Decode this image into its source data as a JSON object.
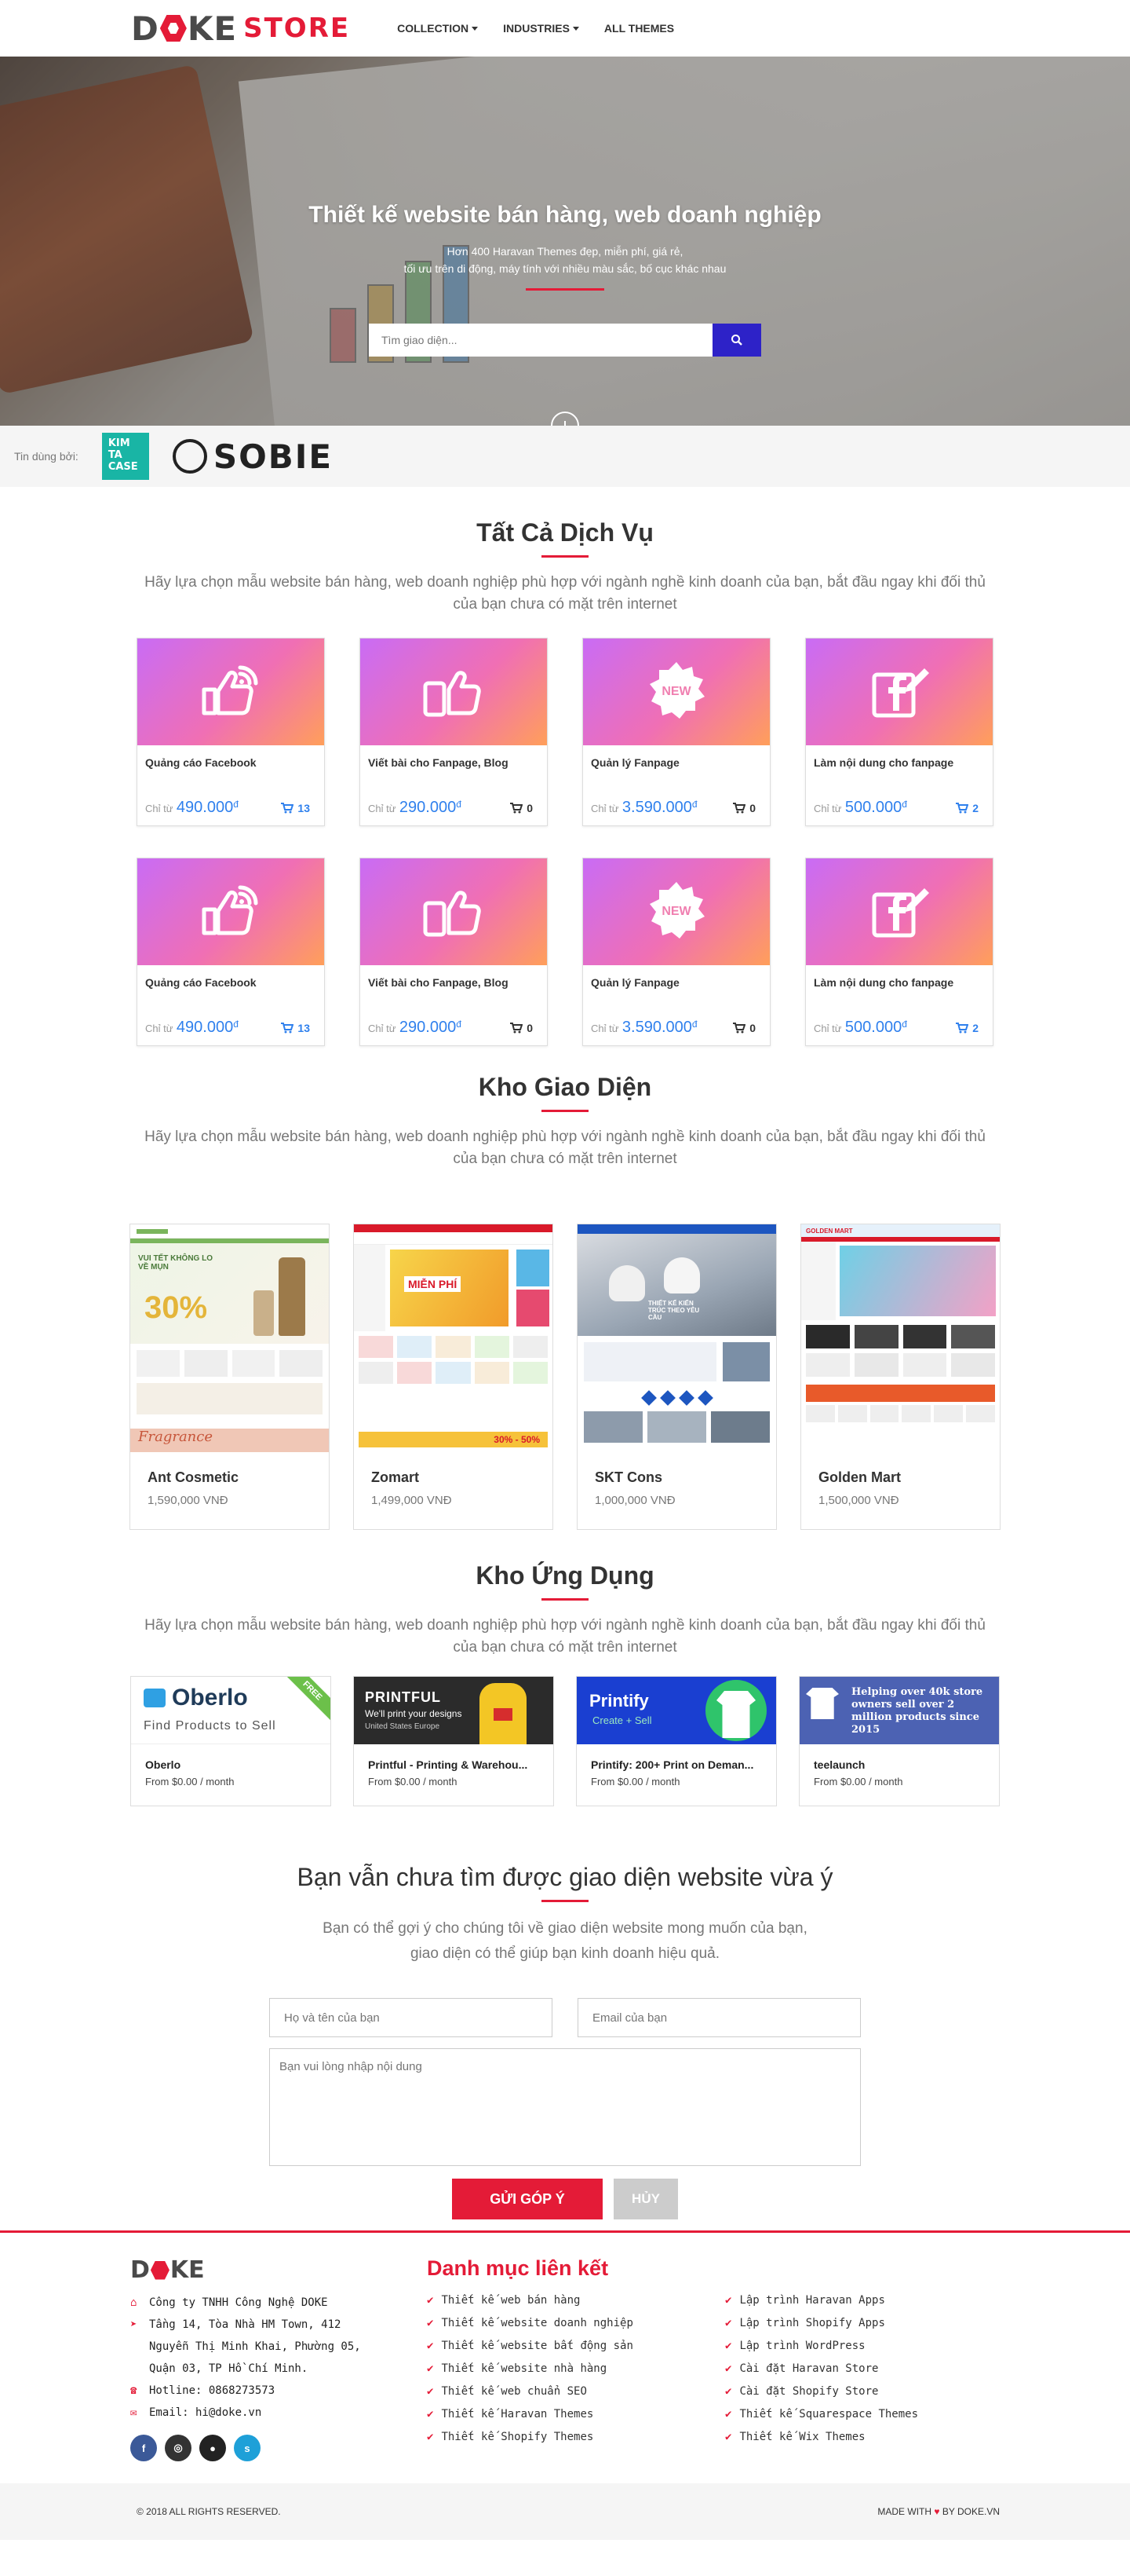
{
  "header": {
    "logo_main": "DOKE",
    "logo_store": "STORE",
    "nav": [
      {
        "label": "COLLECTION",
        "dropdown": true
      },
      {
        "label": "INDUSTRIES",
        "dropdown": true
      },
      {
        "label": "ALL THEMES",
        "dropdown": false
      }
    ]
  },
  "hero": {
    "title": "Thiết kế website bán hàng, web doanh nghiệp",
    "subtitle_1": "Hơn 400 Haravan Themes đẹp, miễn phí, giá rẻ,",
    "subtitle_2": "tối ưu trên di động, máy tính với nhiều màu sắc, bố cục khác nhau",
    "search_placeholder": "Tìm giao diện..."
  },
  "trusted": {
    "label": "Tin dùng bởi:",
    "brands": [
      "KIM TA CASE",
      "SOBIE"
    ]
  },
  "services": {
    "title": "Tất Cả Dịch Vụ",
    "description": "Hãy lựa chọn mẫu website bán hàng, web doanh nghiệp phù hợp với ngành nghề kinh doanh của bạn, bắt đầu ngay khi đối thủ của bạn chưa có mặt trên internet",
    "price_prefix": "Chỉ từ",
    "currency": "đ",
    "items": [
      {
        "name": "Quảng cáo Facebook",
        "price": "490.000",
        "count": "13",
        "icon": "like-wifi-icon",
        "highlight": true
      },
      {
        "name": "Viết bài cho Fanpage, Blog",
        "price": "290.000",
        "count": "0",
        "icon": "phone-thumbs-up-icon",
        "highlight": false
      },
      {
        "name": "Quản lý Fanpage",
        "price": "3.590.000",
        "count": "0",
        "icon": "new-badge-icon",
        "highlight": false
      },
      {
        "name": "Làm nội dung cho fanpage",
        "price": "500.000",
        "count": "2",
        "icon": "facebook-edit-icon",
        "highlight": true
      },
      {
        "name": "Quảng cáo Facebook",
        "price": "490.000",
        "count": "13",
        "icon": "like-wifi-icon",
        "highlight": true
      },
      {
        "name": "Viết bài cho Fanpage, Blog",
        "price": "290.000",
        "count": "0",
        "icon": "phone-thumbs-up-icon",
        "highlight": false
      },
      {
        "name": "Quản lý Fanpage",
        "price": "3.590.000",
        "count": "0",
        "icon": "new-badge-icon",
        "highlight": false
      },
      {
        "name": "Làm nội dung cho fanpage",
        "price": "500.000",
        "count": "2",
        "icon": "facebook-edit-icon",
        "highlight": true
      }
    ]
  },
  "themes": {
    "title": "Kho Giao Diện",
    "description": "Hãy lựa chọn mẫu website bán hàng, web doanh nghiệp phù hợp với ngành nghề kinh doanh của bạn, bắt đầu ngay khi đối thủ của bạn chưa có mặt trên internet",
    "items": [
      {
        "name": "Ant Cosmetic",
        "price": "1,590,000 VNĐ",
        "banner_1": "VUI TẾT KHÔNG LO VỀ MỤN",
        "banner_2": "30%",
        "banner_3": "Fragrance"
      },
      {
        "name": "Zomart",
        "price": "1,499,000 VNĐ",
        "banner_1": "MIỄN PHÍ",
        "banner_2": "30% - 50%"
      },
      {
        "name": "SKT Cons",
        "price": "1,000,000 VNĐ",
        "banner_1": "THIẾT KẾ KIẾN TRÚC THEO YÊU CẦU"
      },
      {
        "name": "Golden Mart",
        "price": "1,500,000 VNĐ",
        "banner_1": "GOLDEN MART"
      }
    ]
  },
  "apps": {
    "title": "Kho Ứng Dụng",
    "description": "Hãy lựa chọn mẫu website bán hàng, web doanh nghiệp phù hợp với ngành nghề kinh doanh của bạn, bắt đầu ngay khi đối thủ của bạn chưa có mặt trên internet",
    "items": [
      {
        "name": "Oberlo",
        "price": "From $0.00 / month",
        "banner_title": "Oberlo",
        "banner_sub": "Find Products to Sell",
        "ribbon": "FREE"
      },
      {
        "name": "Printful - Printing & Warehou...",
        "price": "From $0.00 / month",
        "banner_title": "PRINTFUL",
        "banner_sub": "We'll print your designs",
        "banner_sub2": "United States   Europe"
      },
      {
        "name": "Printify: 200+ Print on Deman...",
        "price": "From $0.00 / month",
        "banner_title": "Printify",
        "banner_sub": "Create + Sell"
      },
      {
        "name": "teelaunch",
        "price": "From $0.00 / month",
        "banner_title": "Helping over 40k store owners sell over 2 million products since 2015"
      }
    ]
  },
  "contact": {
    "title": "Bạn vẫn chưa tìm được giao diện website vừa ý",
    "description_1": "Bạn có thể gợi ý cho chúng tôi về giao diện website mong muốn của bạn,",
    "description_2": "giao diện có thể giúp bạn kinh doanh hiệu quả.",
    "name_placeholder": "Họ và tên của bạn",
    "email_placeholder": "Email của bạn",
    "message_placeholder": "Bạn vui lòng nhập nội dung",
    "submit_label": "GỬI GÓP Ý",
    "cancel_label": "HỦY"
  },
  "footer": {
    "logo": "DOKE",
    "company": "Công ty TNHH Công Nghệ DOKE",
    "address_1": "Tầng 14, Tòa Nhà HM Town, 412",
    "address_2": "Nguyễn Thị Minh Khai, Phường 05,",
    "address_3": "Quận 03, TP Hồ Chí Minh.",
    "hotline": "Hotline: 0868273573",
    "email": "Email: hi@doke.vn",
    "links_title": "Danh mục liên kết",
    "links": [
      "Thiết kế web bán hàng",
      "Lập trình Haravan Apps",
      "Thiết kế website doanh nghiệp",
      "Lập trình Shopify Apps",
      "Thiết kế website bất động sản",
      "Lập trình WordPress",
      "Thiết kế website nhà hàng",
      "Cài đặt Haravan Store",
      "Thiết kế web chuẩn SEO",
      "Cài đặt Shopify Store",
      "Thiết kế Haravan Themes",
      "Thiết kế Squarespace Themes",
      "Thiết kế Shopify Themes",
      "Thiết kế Wix Themes"
    ],
    "copyright": "© 2018 ALL RIGHTS RESERVED.",
    "made_with_1": "MADE WITH",
    "made_with_2": "BY DOKE.VN"
  },
  "colors": {
    "brand_red": "#e41b37",
    "price_blue": "#2f80ed",
    "search_button": "#2d22c8"
  }
}
